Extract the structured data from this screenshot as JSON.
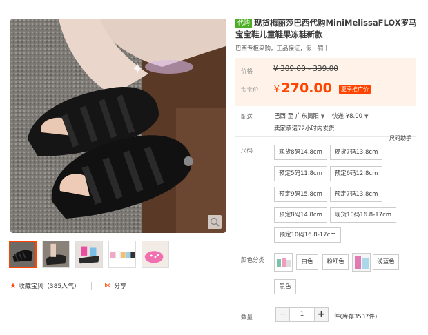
{
  "product": {
    "tag": "代购",
    "title": "现货梅丽莎巴西代购MiniMelissaFLOX罗马宝宝鞋儿童鞋果冻鞋新款",
    "subtitle": "巴西专柜采购，正品保证，假一罚十"
  },
  "price": {
    "label": "价格",
    "original": "¥ 309.00 - 339.00",
    "taobao_label": "淘宝价",
    "currency": "¥",
    "current": "270.00",
    "promo": "夏季推广价"
  },
  "shipping": {
    "label": "配送",
    "from": "巴西 至",
    "to": "广东揭阳",
    "express": "快递 ¥8.00",
    "promise": "卖家承诺72小时内发货"
  },
  "size": {
    "label": "尺码",
    "helper": "尺码助手",
    "options": [
      "现货8码14.8cm",
      "现货7码13.8cm",
      "预定5码11.8cm",
      "预定6码12.8cm",
      "预定9码15.8cm",
      "预定7码13.8cm",
      "预定8码14.8cm",
      "现货10码16.8-17cm",
      "预定10码16.8-17cm"
    ]
  },
  "color": {
    "label": "颜色分类",
    "options": [
      "白色",
      "粉红色",
      "浅蓝色",
      "黑色"
    ]
  },
  "quantity": {
    "label": "数量",
    "value": "1",
    "minus": "−",
    "plus": "+",
    "stock": "件(库存3537件)"
  },
  "social": {
    "favorite": "收藏宝贝",
    "favorite_count": "（385人气）",
    "share": "分享"
  },
  "colors": {
    "accent": "#ff4400",
    "price_bg": "#fff2e8",
    "tag_green": "#4cae23"
  },
  "icons": {
    "star": "★",
    "share": "⋈",
    "zoom": "search-icon",
    "caret": "▼"
  }
}
